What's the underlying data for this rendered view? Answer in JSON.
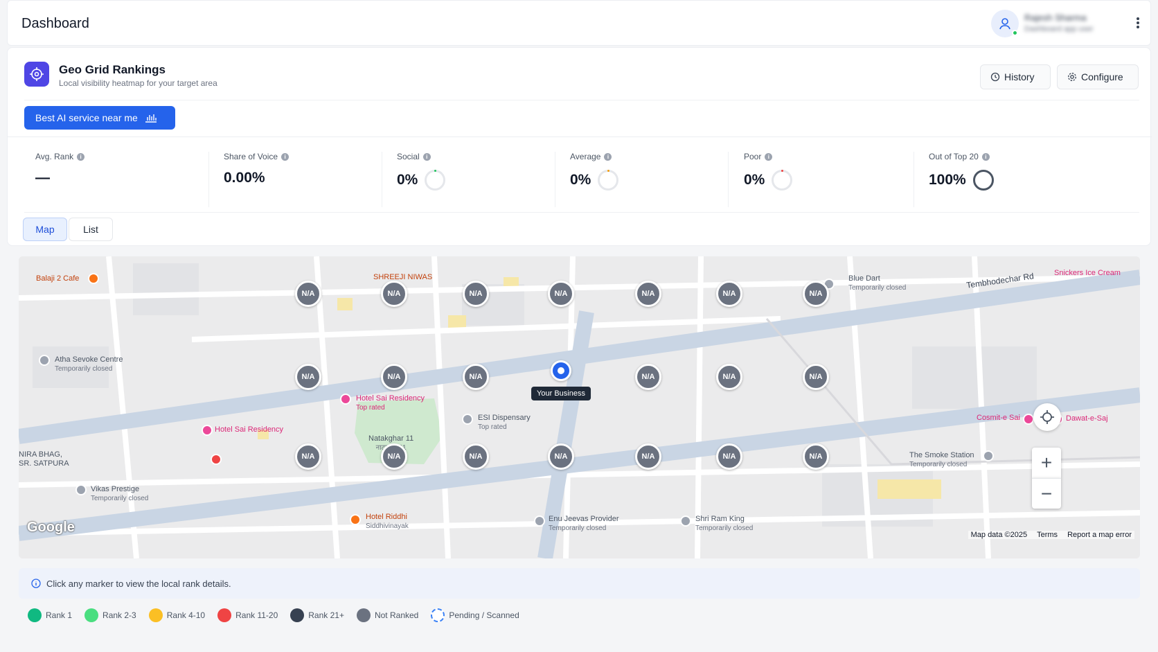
{
  "header": {
    "title": "Dashboard",
    "user_name": "Rajesh Sharma",
    "user_sub": "Dashboard app user"
  },
  "section": {
    "title": "Geo Grid Rankings",
    "subtitle": "Local visibility heatmap for your target area",
    "history_label": "History",
    "configure_label": "Configure",
    "keyword_label": "Best AI service near me"
  },
  "stats": [
    {
      "label": "Avg. Rank",
      "value": "—"
    },
    {
      "label": "Share of Voice",
      "value": "0.00%"
    },
    {
      "label": "Social",
      "value": "0%",
      "ring_color": "#22c55e"
    },
    {
      "label": "Average",
      "value": "0%",
      "ring_color": "#f59e0b"
    },
    {
      "label": "Poor",
      "value": "0%",
      "ring_color": "#ef4444"
    },
    {
      "label": "Out of Top 20",
      "value": "100%",
      "ring_color": "#4b5563",
      "ring_level": 1.0
    }
  ],
  "tabs": [
    "Map",
    "List"
  ],
  "active_tab": "Map",
  "grid_marker_label": "N/A",
  "business_label": "Your Business",
  "map": {
    "road_label_1": "Tembhodechar Rd",
    "pois": {
      "balaji": "Balaji 2 Cafe",
      "shree": "SHREEJI NIWAS",
      "bluedart": "Blue Dart",
      "bluedart_sub": "Temporarily closed",
      "snickers": "Snickers Ice Cream",
      "atha": "Atha Sevoke Centre",
      "atha_sub": "Temporarily closed",
      "hotelsai": "Hotel Sai Residency",
      "hotelsai_sub": "Top rated",
      "esi": "ESI Dispensary",
      "esi_sub": "Top rated",
      "hotelsai2": "Hotel Sai Residency",
      "natak": "Natakghar 11",
      "natak_sub": "नाटकघर 11",
      "vikas": "Vikas Prestige",
      "vikas_sub": "Temporarily closed",
      "riddhi": "Hotel Riddhi",
      "riddhi_sub": "Siddhivinayak",
      "enu": "Enu Jeevas Provider",
      "enu_sub": "Temporarily closed",
      "shriram": "Shri Ram King",
      "shriram_sub": "Temporarily closed",
      "cosmit": "Cosmit-e Sai",
      "dawat": "Dawat-e-Saj",
      "smoke": "The Smoke Station",
      "smoke_sub": "Temporarily closed",
      "satpura": "NIRA BHAG, SR. SATPURA"
    },
    "google_logo": "Google",
    "footer_data": "Map data ©2025",
    "footer_terms": "Terms",
    "footer_report": "Report a map error",
    "zoom_in": "+",
    "zoom_out": "−"
  },
  "hint": "Click any marker to view the local rank details.",
  "legend": [
    {
      "label": "Rank 1",
      "color": "#10b981"
    },
    {
      "label": "Rank 2-3",
      "color": "#4ade80"
    },
    {
      "label": "Rank 4-10",
      "color": "#fbbf24"
    },
    {
      "label": "Rank 11-20",
      "color": "#ef4444"
    },
    {
      "label": "Rank 21+",
      "color": "#374151"
    },
    {
      "label": "Not Ranked",
      "color": "#6b7280"
    },
    {
      "label": "Pending / Scanned",
      "color": "#3b82f6"
    }
  ],
  "colors": {
    "primary": "#2563eb",
    "accent": "#4f46e5",
    "marker": "#6b7280"
  }
}
